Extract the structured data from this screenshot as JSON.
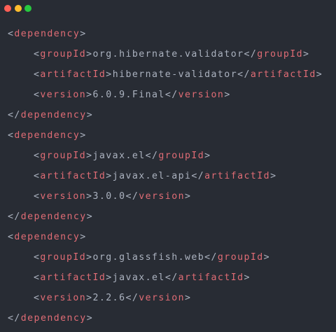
{
  "window": {
    "controls": {
      "close_color": "#ff5f56",
      "minimize_color": "#ffbd2e",
      "maximize_color": "#27c93f"
    }
  },
  "theme": {
    "background": "#282c34",
    "tag_color": "#e06c75",
    "text_color": "#abb2bf"
  },
  "code": {
    "language": "xml",
    "lines": [
      {
        "indent": false,
        "open": "<",
        "tag": "dependency",
        "close": ">",
        "text": "",
        "open2": "",
        "tag2": "",
        "close2": ""
      },
      {
        "indent": true,
        "open": "<",
        "tag": "groupId",
        "close": ">",
        "text": "org.hibernate.validator",
        "open2": "</",
        "tag2": "groupId",
        "close2": ">"
      },
      {
        "indent": true,
        "open": "<",
        "tag": "artifactId",
        "close": ">",
        "text": "hibernate-validator",
        "open2": "</",
        "tag2": "artifactId",
        "close2": ">"
      },
      {
        "indent": true,
        "open": "<",
        "tag": "version",
        "close": ">",
        "text": "6.0.9.Final",
        "open2": "</",
        "tag2": "version",
        "close2": ">"
      },
      {
        "indent": false,
        "open": "</",
        "tag": "dependency",
        "close": ">",
        "text": "",
        "open2": "",
        "tag2": "",
        "close2": ""
      },
      {
        "indent": false,
        "open": "<",
        "tag": "dependency",
        "close": ">",
        "text": "",
        "open2": "",
        "tag2": "",
        "close2": ""
      },
      {
        "indent": true,
        "open": "<",
        "tag": "groupId",
        "close": ">",
        "text": "javax.el",
        "open2": "</",
        "tag2": "groupId",
        "close2": ">"
      },
      {
        "indent": true,
        "open": "<",
        "tag": "artifactId",
        "close": ">",
        "text": "javax.el-api",
        "open2": "</",
        "tag2": "artifactId",
        "close2": ">"
      },
      {
        "indent": true,
        "open": "<",
        "tag": "version",
        "close": ">",
        "text": "3.0.0",
        "open2": "</",
        "tag2": "version",
        "close2": ">"
      },
      {
        "indent": false,
        "open": "</",
        "tag": "dependency",
        "close": ">",
        "text": "",
        "open2": "",
        "tag2": "",
        "close2": ""
      },
      {
        "indent": false,
        "open": "<",
        "tag": "dependency",
        "close": ">",
        "text": "",
        "open2": "",
        "tag2": "",
        "close2": ""
      },
      {
        "indent": true,
        "open": "<",
        "tag": "groupId",
        "close": ">",
        "text": "org.glassfish.web",
        "open2": "</",
        "tag2": "groupId",
        "close2": ">"
      },
      {
        "indent": true,
        "open": "<",
        "tag": "artifactId",
        "close": ">",
        "text": "javax.el",
        "open2": "</",
        "tag2": "artifactId",
        "close2": ">"
      },
      {
        "indent": true,
        "open": "<",
        "tag": "version",
        "close": ">",
        "text": "2.2.6",
        "open2": "</",
        "tag2": "version",
        "close2": ">"
      },
      {
        "indent": false,
        "open": "</",
        "tag": "dependency",
        "close": ">",
        "text": "",
        "open2": "",
        "tag2": "",
        "close2": ""
      }
    ]
  }
}
